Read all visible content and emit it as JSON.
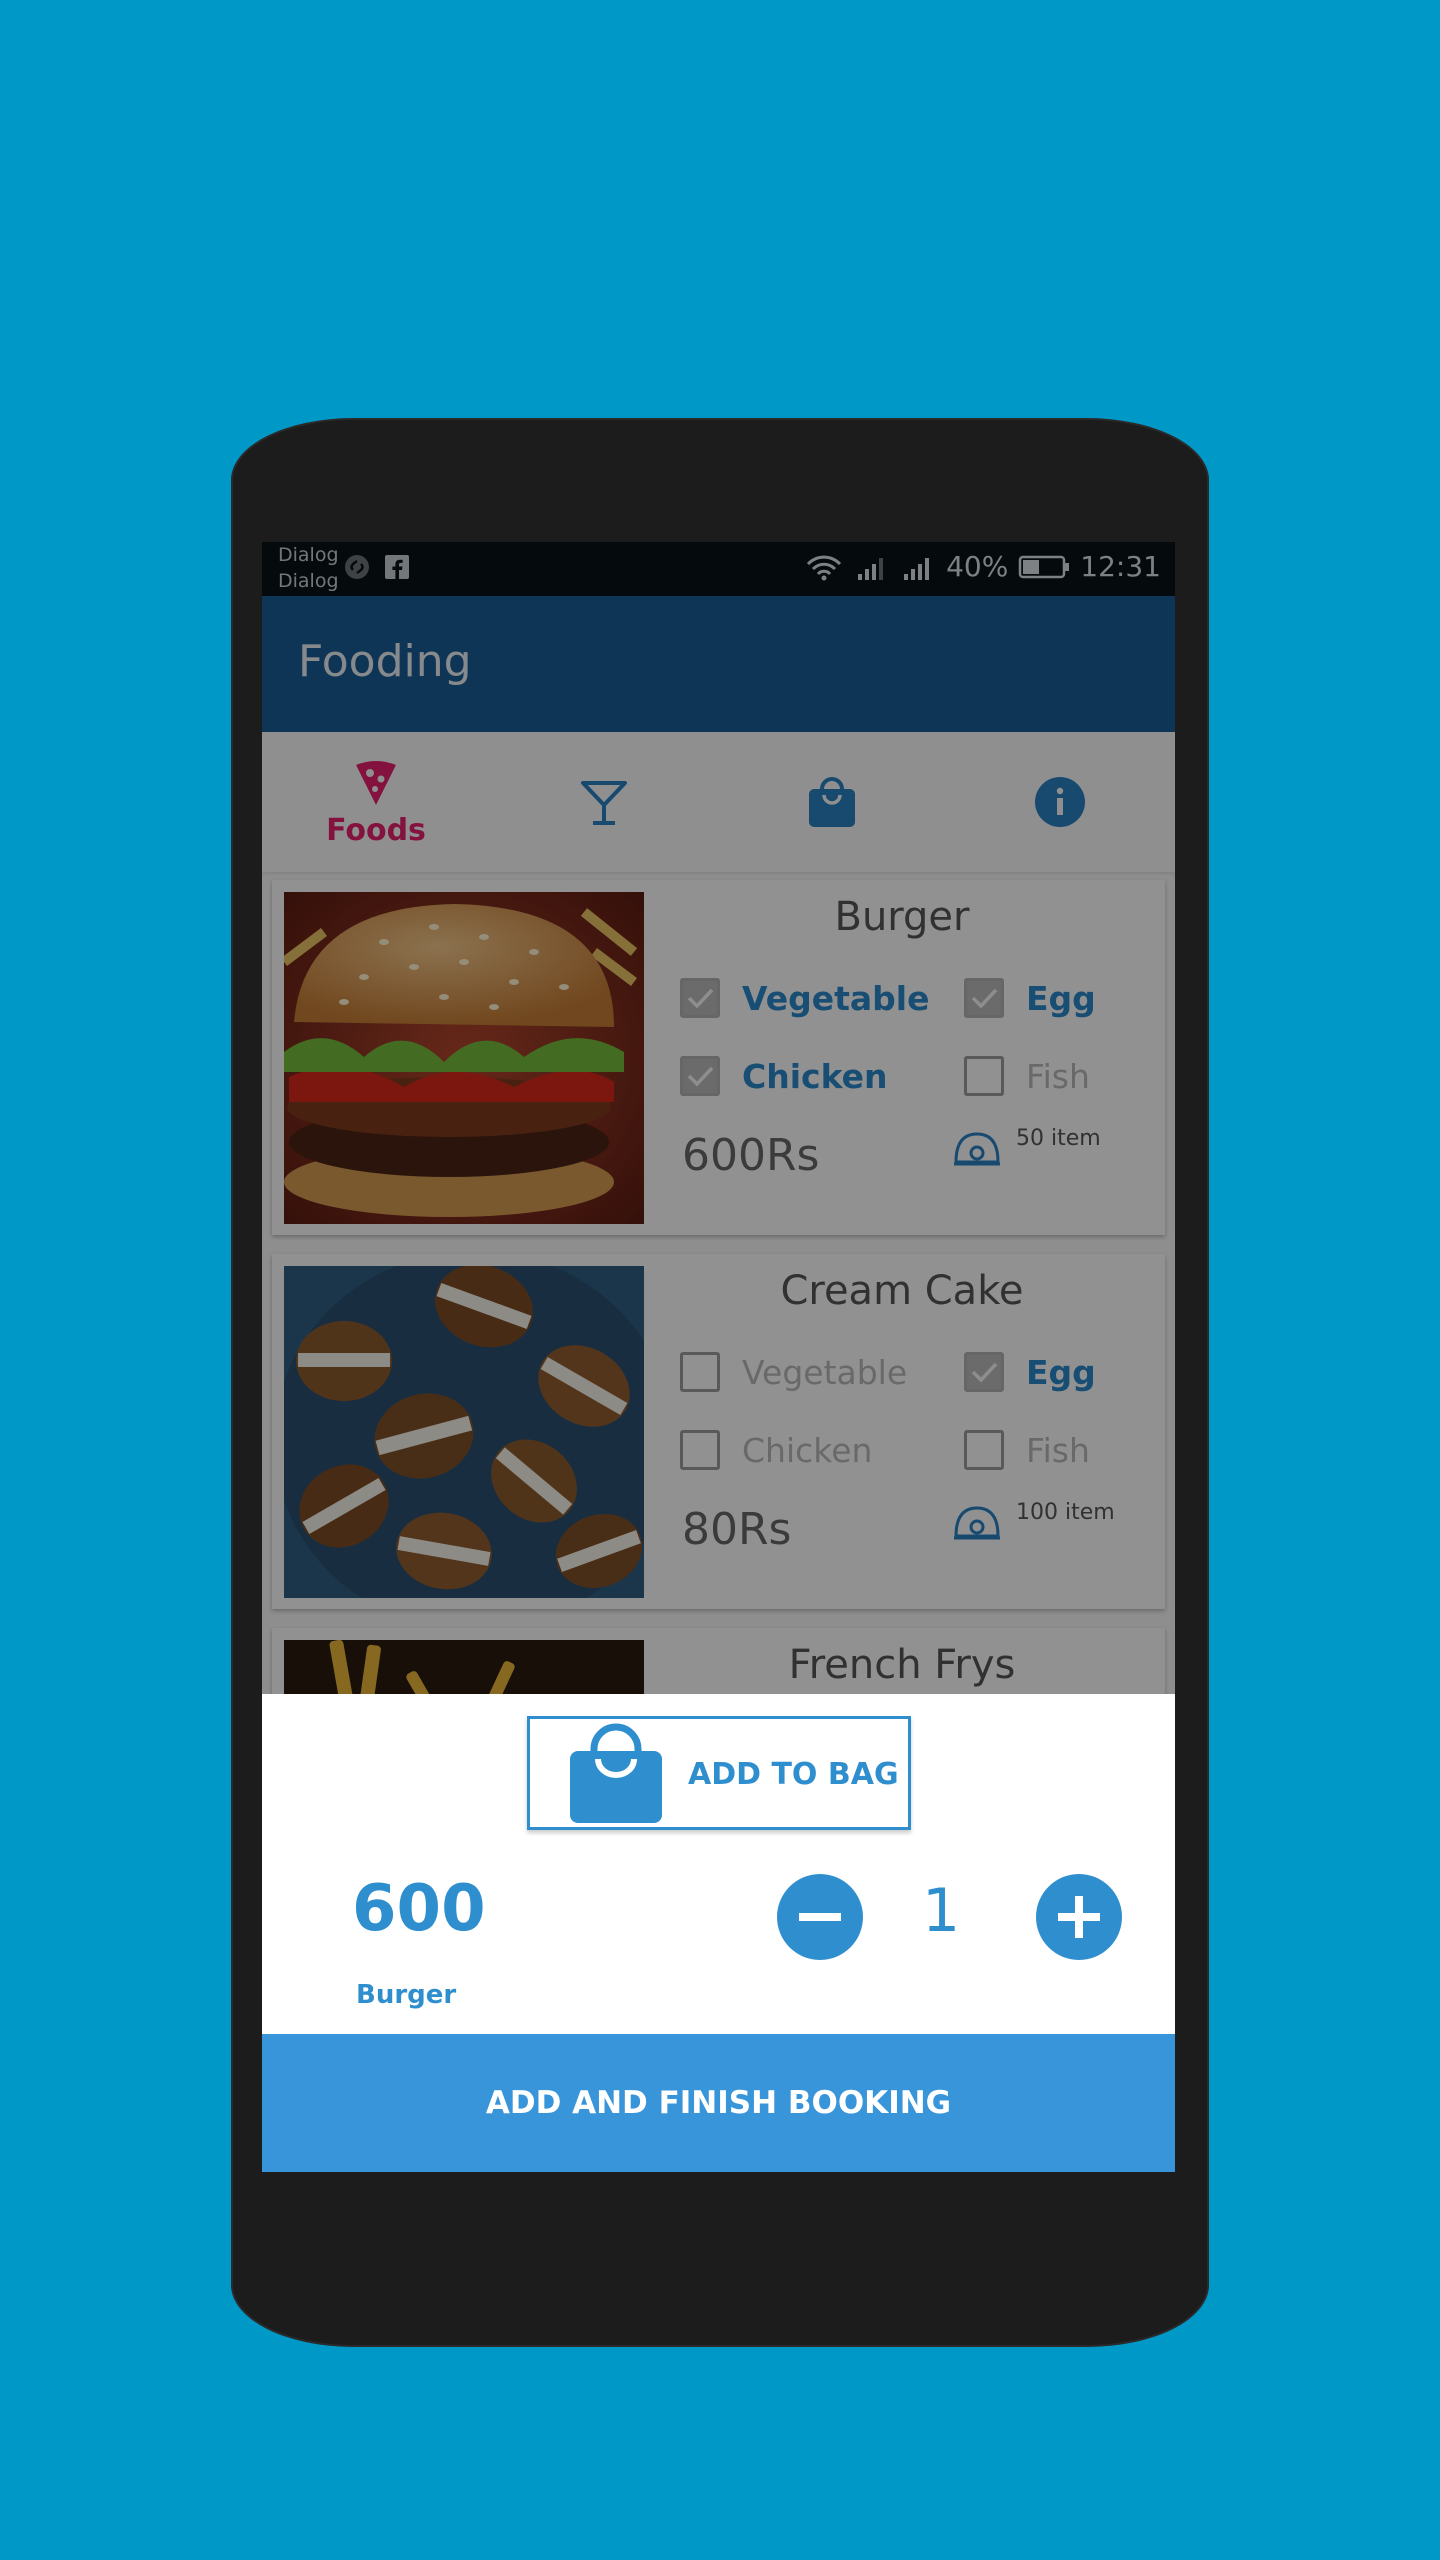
{
  "status_bar": {
    "notification_line1": "Dialog",
    "notification_line2": "Dialog",
    "battery_percent": "40%",
    "time": "12:31"
  },
  "app_bar": {
    "title": "Fooding"
  },
  "tabs": [
    {
      "label": "Foods",
      "icon": "pizza-slice-icon"
    },
    {
      "label": "",
      "icon": "cocktail-icon"
    },
    {
      "label": "",
      "icon": "shopping-bag-icon"
    },
    {
      "label": "",
      "icon": "info-icon"
    }
  ],
  "items": [
    {
      "name": "Burger",
      "options": [
        {
          "label": "Vegetable",
          "checked": true
        },
        {
          "label": "Egg",
          "checked": true
        },
        {
          "label": "Chicken",
          "checked": true
        },
        {
          "label": "Fish",
          "checked": false
        }
      ],
      "price": "600Rs",
      "stock": "50 item"
    },
    {
      "name": "Cream Cake",
      "options": [
        {
          "label": "Vegetable",
          "checked": false
        },
        {
          "label": "Egg",
          "checked": true
        },
        {
          "label": "Chicken",
          "checked": false
        },
        {
          "label": "Fish",
          "checked": false
        }
      ],
      "price": "80Rs",
      "stock": "100 item"
    },
    {
      "name": "French Frys"
    }
  ],
  "sheet": {
    "add_to_bag_label": "ADD TO BAG",
    "total": "600",
    "item_name": "Burger",
    "quantity": "1",
    "finish_label": "ADD AND FINISH BOOKING"
  },
  "colors": {
    "background": "#0098c6",
    "app_bar": "#1b5c94",
    "accent": "#2f8fce",
    "tab_active": "#e4206b",
    "finish_button": "#3895da"
  }
}
